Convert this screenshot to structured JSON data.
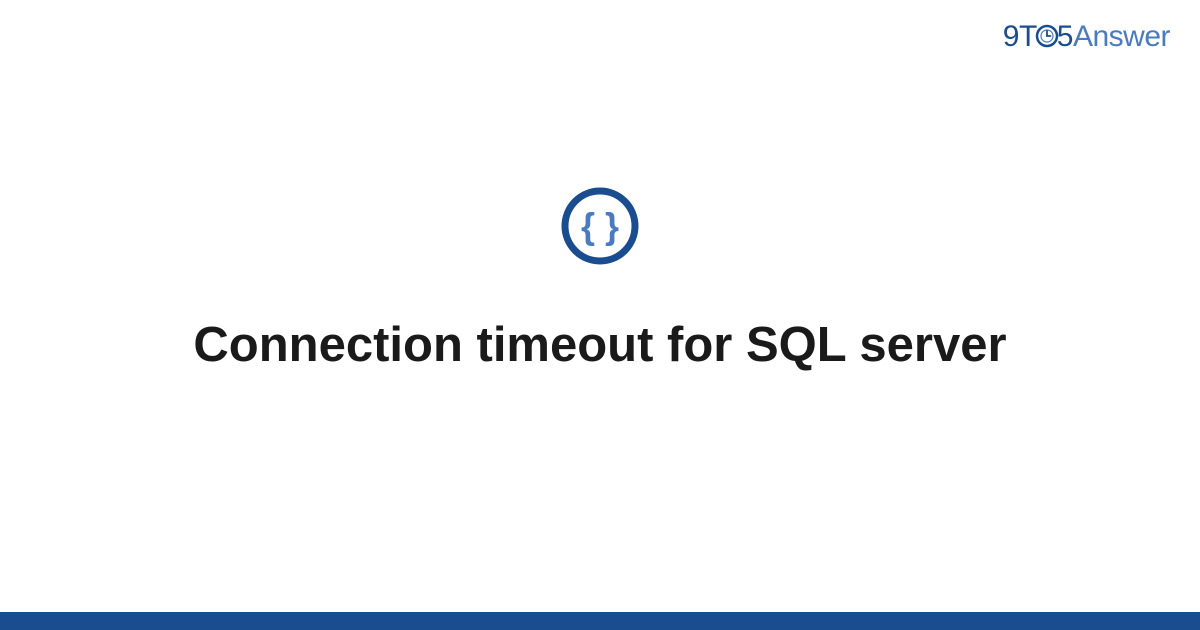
{
  "brand": {
    "part1": "9",
    "part2": "T",
    "part3": "5",
    "part4": "Answer"
  },
  "main": {
    "title": "Connection timeout for SQL server"
  },
  "colors": {
    "brand_dark": "#1a4d8f",
    "brand_light": "#4a7bc0",
    "text": "#1a1a1a",
    "background": "#ffffff"
  },
  "icon": {
    "semantic": "code-braces-icon"
  }
}
